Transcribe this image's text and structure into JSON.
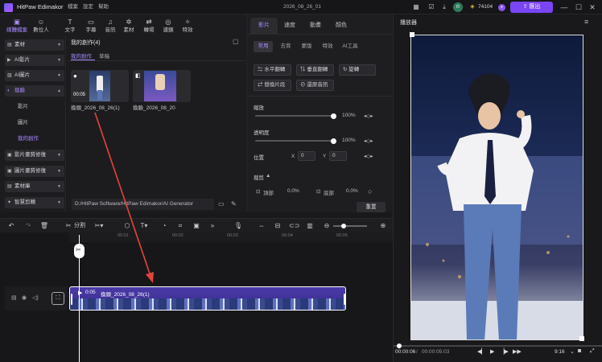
{
  "app": {
    "name": "HitPaw Edimakor",
    "menu": [
      "檔案",
      "設定",
      "幫助"
    ],
    "doc_title": "2026_08_26_01",
    "points": "74104",
    "avatar_letter": "n",
    "export": "匯出"
  },
  "toptools": [
    {
      "label": "媒體檔案",
      "icon": "folder"
    },
    {
      "label": "數位人",
      "icon": "person"
    },
    {
      "label": "文字",
      "icon": "text"
    },
    {
      "label": "字幕",
      "icon": "subtitle"
    },
    {
      "label": "音訊",
      "icon": "music"
    },
    {
      "label": "素材",
      "icon": "sticker"
    },
    {
      "label": "轉場",
      "icon": "transition"
    },
    {
      "label": "濾鏡",
      "icon": "filter"
    },
    {
      "label": "特效",
      "icon": "effect"
    }
  ],
  "sidebar": {
    "items": [
      {
        "label": "素材"
      },
      {
        "label": "AI影片"
      },
      {
        "label": "AI圖片"
      },
      {
        "label": "換臉"
      }
    ],
    "subs": [
      {
        "label": "影片"
      },
      {
        "label": "圖片"
      },
      {
        "label": "我的創作"
      }
    ],
    "items2": [
      {
        "label": "影片畫質修復"
      },
      {
        "label": "圖片畫質修復"
      },
      {
        "label": "素材庫"
      },
      {
        "label": "智慧剪輯"
      }
    ]
  },
  "media": {
    "title": "我的創作(4)",
    "tabs": [
      "我的創作",
      "草稿"
    ],
    "items": [
      {
        "name": "換頭_2026_08_26(1)",
        "duration": "00:05"
      },
      {
        "name": "換臉_2026_08_20"
      }
    ],
    "path": "D:/HitPaw Software/HitPaw Edimakor/AI Generator"
  },
  "props": {
    "tabs": [
      "影片",
      "速度",
      "動畫",
      "顏色"
    ],
    "subtabs": [
      "常用",
      "去背",
      "蒙版",
      "特效",
      "AI工具"
    ],
    "buttons": [
      "水平翻轉",
      "垂直翻轉",
      "旋轉",
      "替換片段",
      "還原音訊"
    ],
    "scale_label": "縮放",
    "scale_value": "100%",
    "opacity_label": "透明度",
    "opacity_value": "100%",
    "position_label": "位置",
    "x_label": "X",
    "x_value": "0",
    "y_label": "Y",
    "y_value": "0",
    "crop_label": "裁剪",
    "top_label": "頂部",
    "top_value": "0.0%",
    "bottom_label": "底部",
    "bottom_value": "0.0%",
    "reset": "重置",
    "scale_level": 1.0,
    "opacity_level": 1.0
  },
  "player": {
    "title": "播放器",
    "time_current": "00:00:06",
    "time_total": "00:00:05:03",
    "aspect": "9:16"
  },
  "timeline": {
    "split": "分割",
    "ruler": [
      "00:01",
      "00:02",
      "00:03",
      "00:04",
      "00:05"
    ],
    "clip_duration": "0:05",
    "clip_name": "換頭_2026_08_26(1)"
  }
}
